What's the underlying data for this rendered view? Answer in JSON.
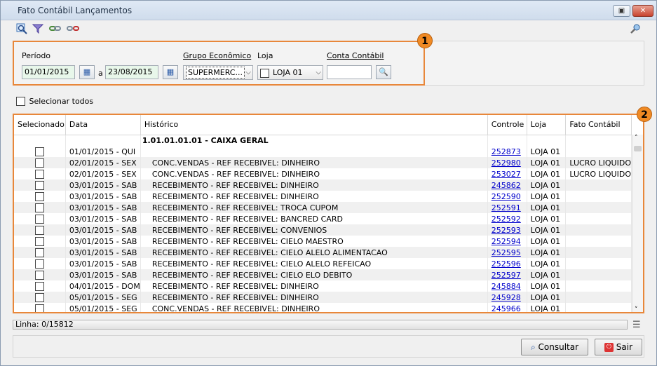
{
  "window": {
    "title": "Fato Contábil Lançamentos",
    "restore_glyph": "▣",
    "close_glyph": "✕"
  },
  "toolbar": {
    "icons": [
      "search-icon",
      "filter-icon",
      "link-icon",
      "unlink-icon",
      "key-search-icon"
    ]
  },
  "filters": {
    "badge": "1",
    "periodo_label": "Período",
    "date_from": "01/01/2015",
    "a_label": "a",
    "date_to": "23/08/2015",
    "grupo_label": "Grupo Econômico",
    "grupo_value": "SUPERMERC...",
    "loja_label": "Loja",
    "loja_value": "LOJA 01",
    "conta_label": "Conta Contábil",
    "conta_value": ""
  },
  "select_all_label": "Selecionar todos",
  "grid": {
    "badge": "2",
    "columns": [
      "Selecionado",
      "Data",
      "Histórico",
      "Controle",
      "Loja",
      "Fato Contábil"
    ],
    "group_header": "1.01.01.01.01 - CAIXA GERAL",
    "rows": [
      {
        "data": "01/01/2015 - QUI",
        "historico": "",
        "controle": "252873",
        "loja": "LOJA 01",
        "fato": ""
      },
      {
        "data": "02/01/2015 - SEX",
        "historico": "CONC.VENDAS  - REF RECEBIVEL: DINHEIRO",
        "controle": "252980",
        "loja": "LOJA 01",
        "fato": "LUCRO LIQUIDO"
      },
      {
        "data": "02/01/2015 - SEX",
        "historico": "CONC.VENDAS  - REF RECEBIVEL: DINHEIRO",
        "controle": "253027",
        "loja": "LOJA 01",
        "fato": "LUCRO LIQUIDO"
      },
      {
        "data": "03/01/2015 - SAB",
        "historico": "RECEBIMENTO  - REF RECEBIVEL: DINHEIRO",
        "controle": "245862",
        "loja": "LOJA 01",
        "fato": ""
      },
      {
        "data": "03/01/2015 - SAB",
        "historico": "RECEBIMENTO  - REF RECEBIVEL: DINHEIRO",
        "controle": "252590",
        "loja": "LOJA 01",
        "fato": ""
      },
      {
        "data": "03/01/2015 - SAB",
        "historico": "RECEBIMENTO  - REF RECEBIVEL: TROCA CUPOM",
        "controle": "252591",
        "loja": "LOJA 01",
        "fato": ""
      },
      {
        "data": "03/01/2015 - SAB",
        "historico": "RECEBIMENTO  - REF RECEBIVEL: BANCRED CARD",
        "controle": "252592",
        "loja": "LOJA 01",
        "fato": ""
      },
      {
        "data": "03/01/2015 - SAB",
        "historico": "RECEBIMENTO  - REF RECEBIVEL: CONVENIOS",
        "controle": "252593",
        "loja": "LOJA 01",
        "fato": ""
      },
      {
        "data": "03/01/2015 - SAB",
        "historico": "RECEBIMENTO  - REF RECEBIVEL: CIELO MAESTRO",
        "controle": "252594",
        "loja": "LOJA 01",
        "fato": ""
      },
      {
        "data": "03/01/2015 - SAB",
        "historico": "RECEBIMENTO  - REF RECEBIVEL: CIELO ALELO ALIMENTACAO",
        "controle": "252595",
        "loja": "LOJA 01",
        "fato": ""
      },
      {
        "data": "03/01/2015 - SAB",
        "historico": "RECEBIMENTO  - REF RECEBIVEL: CIELO ALELO REFEICAO",
        "controle": "252596",
        "loja": "LOJA 01",
        "fato": ""
      },
      {
        "data": "03/01/2015 - SAB",
        "historico": "RECEBIMENTO  - REF RECEBIVEL: CIELO ELO DEBITO",
        "controle": "252597",
        "loja": "LOJA 01",
        "fato": ""
      },
      {
        "data": "04/01/2015 - DOM",
        "historico": "RECEBIMENTO  - REF RECEBIVEL: DINHEIRO",
        "controle": "245884",
        "loja": "LOJA 01",
        "fato": ""
      },
      {
        "data": "05/01/2015 - SEG",
        "historico": "RECEBIMENTO  - REF RECEBIVEL: DINHEIRO",
        "controle": "245928",
        "loja": "LOJA 01",
        "fato": ""
      },
      {
        "data": "05/01/2015 - SEG",
        "historico": "CONC.VENDAS  - REF RECEBIVEL: DINHEIRO",
        "controle": "245966",
        "loja": "LOJA 01",
        "fato": ""
      }
    ]
  },
  "status": {
    "linha": "Linha: 0/15812"
  },
  "buttons": {
    "consultar": "Consultar",
    "sair": "Sair"
  },
  "colors": {
    "highlight_border": "#e8873a",
    "badge": "#f08a24",
    "link": "#0000cc"
  }
}
